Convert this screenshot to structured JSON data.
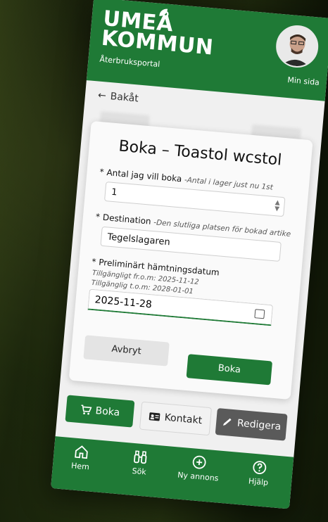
{
  "header": {
    "logo_line1": "UMEÅ",
    "logo_line2": "KOMMUN",
    "subtitle": "Återbruksportal",
    "profile_label": "Min sida"
  },
  "nav": {
    "back_label": "Bakåt"
  },
  "modal": {
    "title": "Boka – Toastol wcstol",
    "quantity": {
      "required_mark": "*",
      "label": "Antal jag vill boka",
      "hint": "-Antal i lager just nu 1st",
      "value": "1"
    },
    "destination": {
      "required_mark": "*",
      "label": "Destination",
      "hint": "-Den slutliga platsen för bokad artike",
      "value": "Tegelslagaren"
    },
    "pickup": {
      "required_mark": "*",
      "label": "Preliminärt hämtningsdatum",
      "available_from": "Tillgängligt fr.o.m:  2025-11-12",
      "available_to": "Tillgänglig t.o.m:  2028-01-01",
      "value": "2025-11-28"
    },
    "cancel_label": "Avbryt",
    "confirm_label": "Boka"
  },
  "actions": {
    "book_label": "Boka",
    "contact_label": "Kontakt",
    "edit_label": "Redigera"
  },
  "bottom_nav": {
    "home": "Hem",
    "search": "Sök",
    "new_ad": "Ny annons",
    "help": "Hjälp"
  },
  "colors": {
    "brand_green": "#1f7a36",
    "edit_gray": "#5a5a5a"
  }
}
